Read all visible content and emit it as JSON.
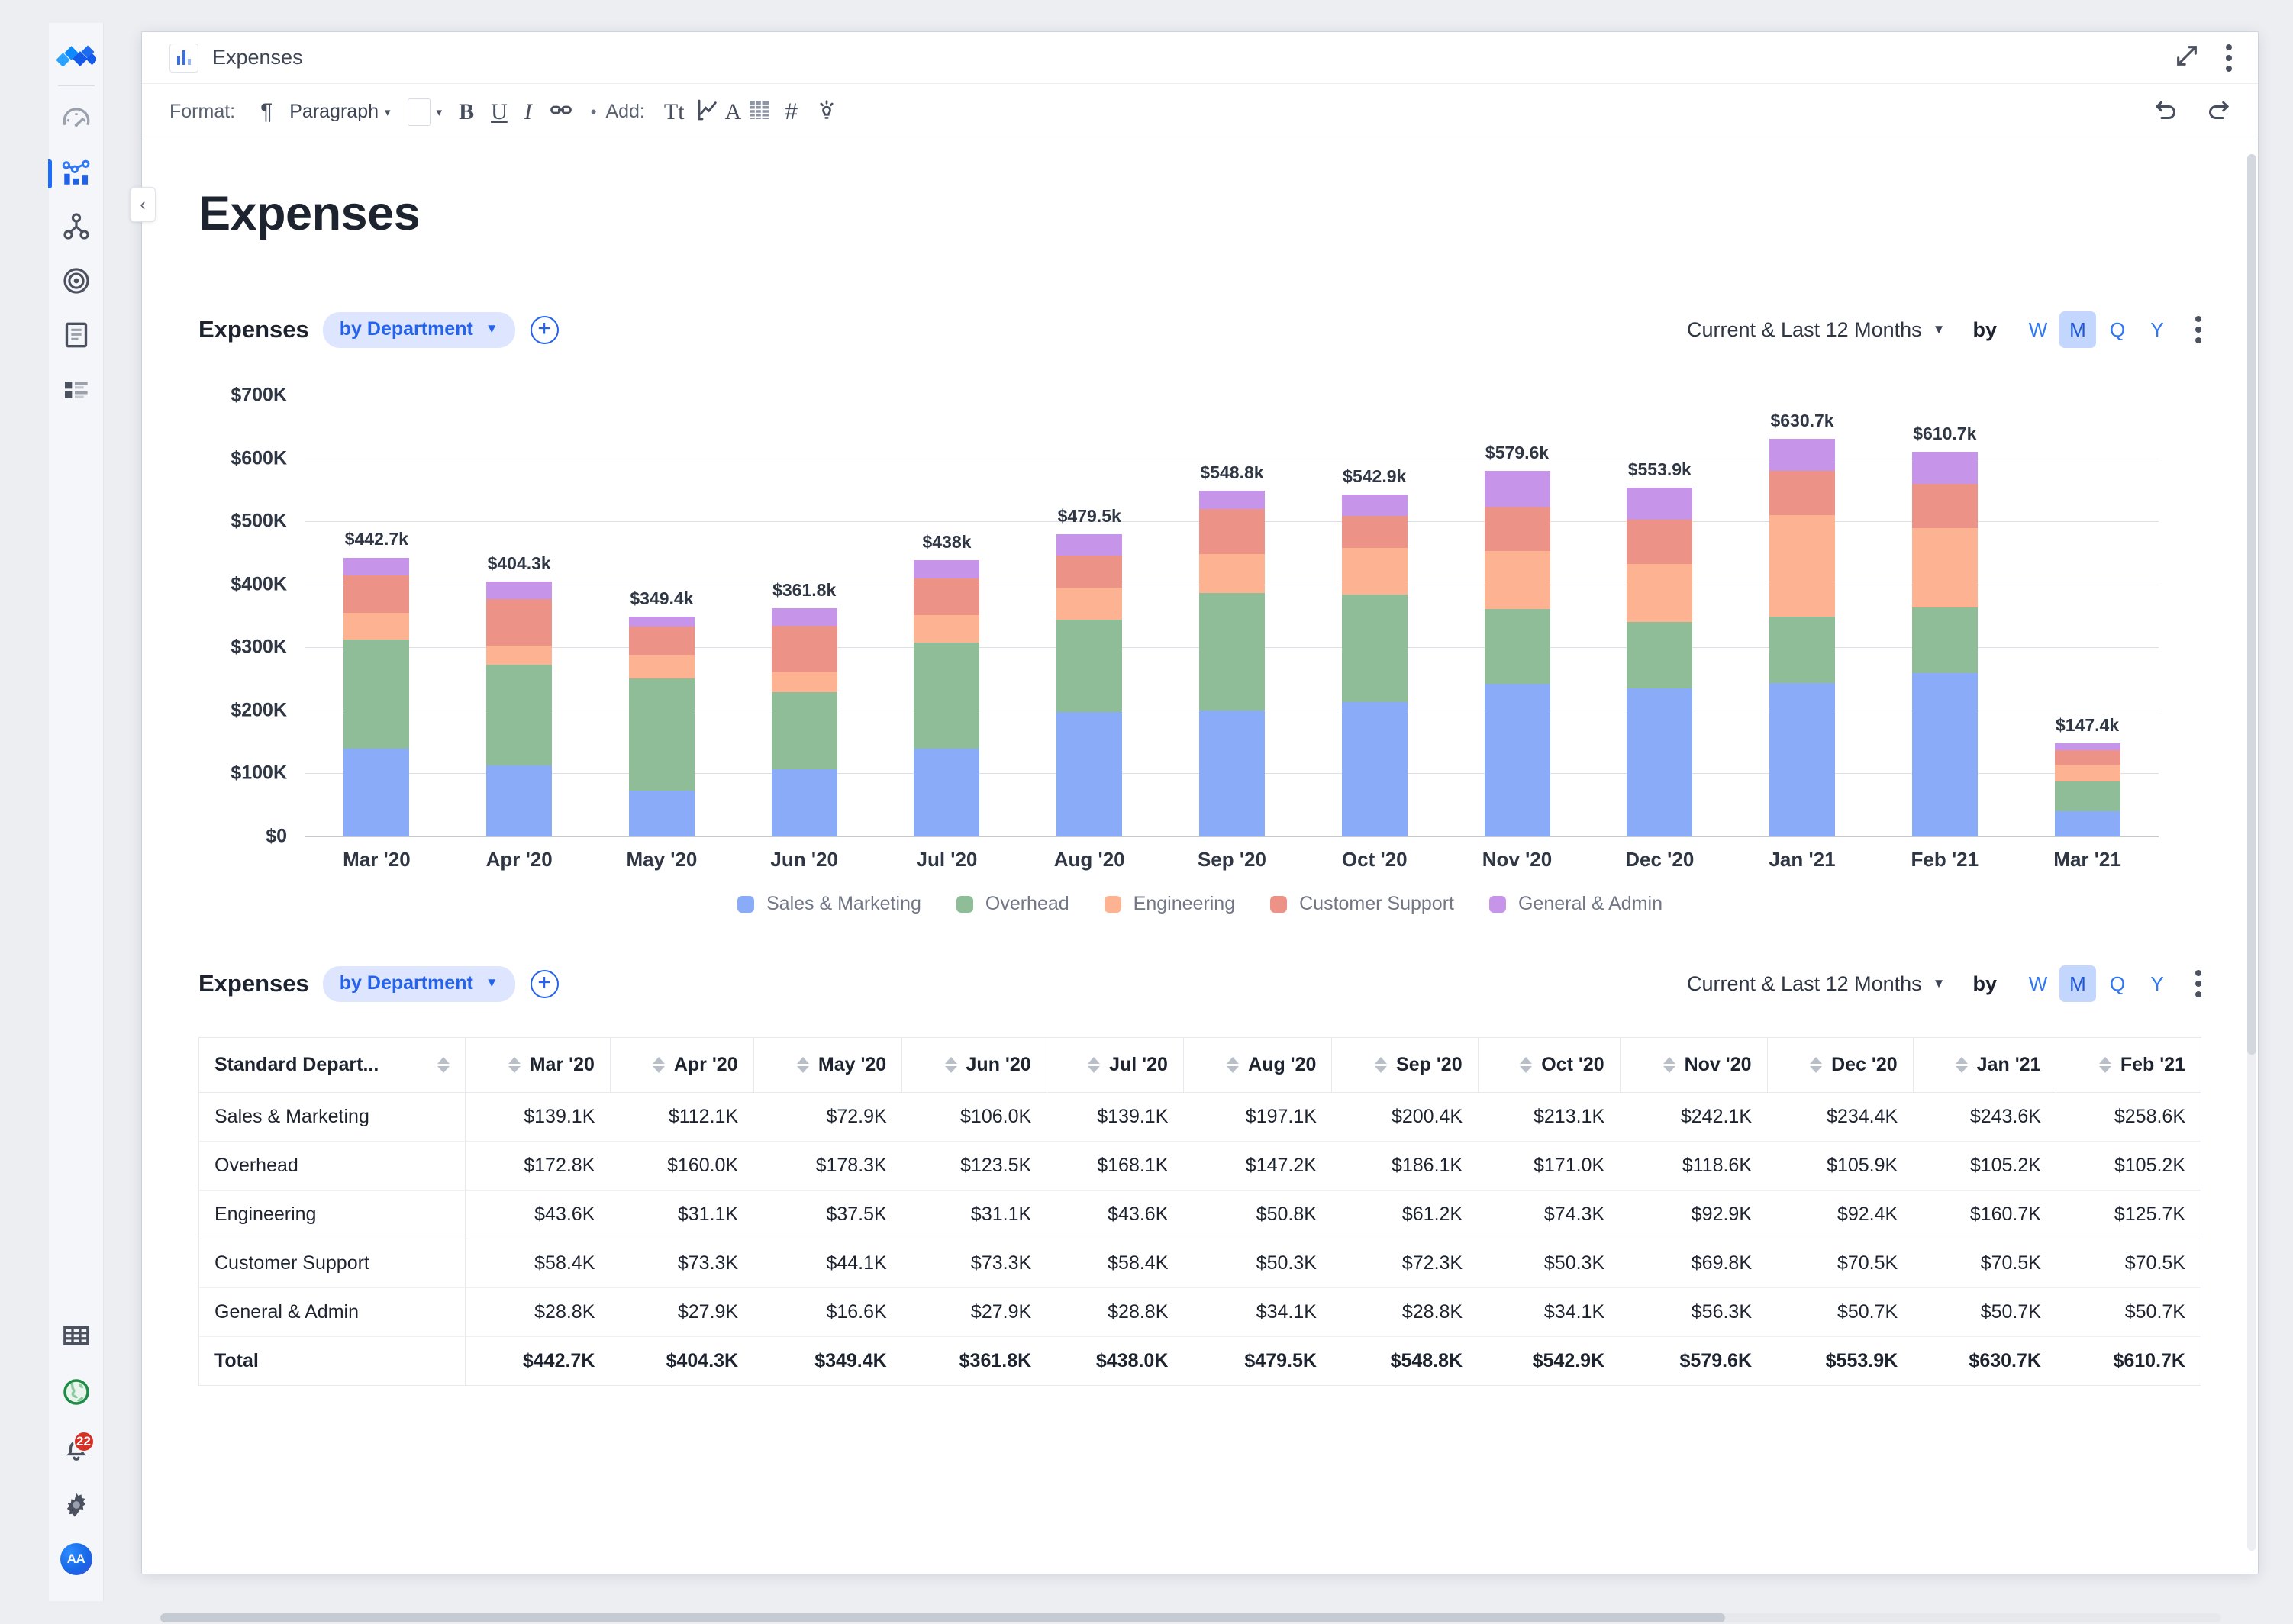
{
  "app": {
    "logo_icon": "diamond-cluster-logo",
    "rail_items": [
      {
        "icon": "gauge-icon",
        "name": "dashboard"
      },
      {
        "icon": "chart-network-icon",
        "name": "metrics",
        "active": true
      },
      {
        "icon": "share-nodes-icon",
        "name": "relationships"
      },
      {
        "icon": "target-icon",
        "name": "goals"
      },
      {
        "icon": "document-icon",
        "name": "documents"
      },
      {
        "icon": "list-detail-icon",
        "name": "reports"
      }
    ],
    "rail_bottom": [
      {
        "icon": "table-grid-icon",
        "name": "data-tables"
      },
      {
        "icon": "globe-icon",
        "name": "explore"
      },
      {
        "icon": "bell-icon",
        "name": "notifications",
        "badge": "22"
      },
      {
        "icon": "gear-icon",
        "name": "settings"
      },
      {
        "icon": "avatar",
        "name": "user-avatar",
        "initials": "AA"
      }
    ]
  },
  "window": {
    "doc_icon": "bar-chart-doc-icon",
    "title": "Expenses",
    "expand_icon": "expand-arrow-icon",
    "menu_icon": "kebab-menu-icon"
  },
  "toolbar": {
    "format_label": "Format:",
    "paragraph_icon": "pilcrow-icon",
    "paragraph_label": "Paragraph",
    "color_swatch": "#ffffff",
    "bold_label": "B",
    "underline_label": "U",
    "italic_label": "I",
    "link_icon": "link-icon",
    "separator": "•",
    "add_label": "Add:",
    "text_icon": "Tt",
    "chart_icon": "line-chart-icon",
    "text_a_icon": "A",
    "table_icon": "table-icon",
    "hash_icon": "#",
    "insight_icon": "lightbulb-icon",
    "undo_icon": "undo-icon",
    "redo_icon": "redo-icon"
  },
  "collapse_handle_icon": "chevron-left-icon",
  "page": {
    "title": "Expenses"
  },
  "chart_block": {
    "title": "Expenses",
    "group_pill": "by Department",
    "pill_caret": "▼",
    "add_icon": "plus-circle-icon",
    "range": "Current & Last 12 Months",
    "range_caret": "▼",
    "by_label": "by",
    "granularity": [
      "W",
      "M",
      "Q",
      "Y"
    ],
    "granularity_selected": "M",
    "menu_icon": "kebab-menu-icon"
  },
  "table_block": {
    "title": "Expenses",
    "group_pill": "by Department",
    "pill_caret": "▼",
    "add_icon": "plus-circle-icon",
    "range": "Current & Last 12 Months",
    "range_caret": "▼",
    "by_label": "by",
    "granularity": [
      "W",
      "M",
      "Q",
      "Y"
    ],
    "granularity_selected": "M",
    "menu_icon": "kebab-menu-icon"
  },
  "chart_data": {
    "type": "bar",
    "stacked": true,
    "title": "Expenses",
    "xlabel": "",
    "ylabel": "",
    "ylim": [
      0,
      700000
    ],
    "ytick_labels": [
      "$0",
      "$100K",
      "$200K",
      "$300K",
      "$400K",
      "$500K",
      "$600K",
      "$700K"
    ],
    "ytick_values": [
      0,
      100000,
      200000,
      300000,
      400000,
      500000,
      600000,
      700000
    ],
    "grid": true,
    "legend_position": "bottom",
    "categories": [
      "Mar '20",
      "Apr '20",
      "May '20",
      "Jun '20",
      "Jul '20",
      "Aug '20",
      "Sep '20",
      "Oct '20",
      "Nov '20",
      "Dec '20",
      "Jan '21",
      "Feb '21",
      "Mar '21"
    ],
    "series": [
      {
        "name": "Sales & Marketing",
        "color": "#8aabf7",
        "values": [
          139100,
          112100,
          72900,
          106000,
          139100,
          197100,
          200400,
          213100,
          242100,
          234400,
          243600,
          258600,
          39900
        ]
      },
      {
        "name": "Overhead",
        "color": "#8ebd97",
        "values": [
          172800,
          160000,
          178300,
          123500,
          168100,
          147200,
          186100,
          171000,
          118600,
          105900,
          105200,
          105200,
          47900
        ]
      },
      {
        "name": "Engineering",
        "color": "#fdb391",
        "values": [
          43600,
          31100,
          37500,
          31100,
          43600,
          50800,
          61200,
          74300,
          92900,
          92400,
          160700,
          125700,
          26300
        ]
      },
      {
        "name": "Customer Support",
        "color": "#ec9287",
        "values": [
          58400,
          73300,
          44100,
          73300,
          58400,
          50300,
          72300,
          50300,
          69800,
          70500,
          70500,
          70500,
          23100
        ]
      },
      {
        "name": "General & Admin",
        "color": "#c694e8",
        "values": [
          28800,
          27900,
          16600,
          27900,
          28800,
          34100,
          28800,
          34100,
          56300,
          50700,
          50700,
          50700,
          10200
        ]
      }
    ],
    "totals": [
      442700,
      404300,
      349400,
      361800,
      438000,
      479500,
      548800,
      542900,
      579600,
      553900,
      630700,
      610700,
      147400
    ],
    "total_labels": [
      "$442.7k",
      "$404.3k",
      "$349.4k",
      "$361.8k",
      "$438k",
      "$479.5k",
      "$548.8k",
      "$542.9k",
      "$579.6k",
      "$553.9k",
      "$630.7k",
      "$610.7k",
      "$147.4k"
    ]
  },
  "table_data": {
    "type": "table",
    "columns": [
      "Standard Depart...",
      "Mar '20",
      "Apr '20",
      "May '20",
      "Jun '20",
      "Jul '20",
      "Aug '20",
      "Sep '20",
      "Oct '20",
      "Nov '20",
      "Dec '20",
      "Jan '21",
      "Feb '21"
    ],
    "rows": [
      {
        "label": "Sales & Marketing",
        "values": [
          "$139.1K",
          "$112.1K",
          "$72.9K",
          "$106.0K",
          "$139.1K",
          "$197.1K",
          "$200.4K",
          "$213.1K",
          "$242.1K",
          "$234.4K",
          "$243.6K",
          "$258.6K"
        ]
      },
      {
        "label": "Overhead",
        "values": [
          "$172.8K",
          "$160.0K",
          "$178.3K",
          "$123.5K",
          "$168.1K",
          "$147.2K",
          "$186.1K",
          "$171.0K",
          "$118.6K",
          "$105.9K",
          "$105.2K",
          "$105.2K"
        ]
      },
      {
        "label": "Engineering",
        "values": [
          "$43.6K",
          "$31.1K",
          "$37.5K",
          "$31.1K",
          "$43.6K",
          "$50.8K",
          "$61.2K",
          "$74.3K",
          "$92.9K",
          "$92.4K",
          "$160.7K",
          "$125.7K"
        ]
      },
      {
        "label": "Customer Support",
        "values": [
          "$58.4K",
          "$73.3K",
          "$44.1K",
          "$73.3K",
          "$58.4K",
          "$50.3K",
          "$72.3K",
          "$50.3K",
          "$69.8K",
          "$70.5K",
          "$70.5K",
          "$70.5K"
        ]
      },
      {
        "label": "General & Admin",
        "values": [
          "$28.8K",
          "$27.9K",
          "$16.6K",
          "$27.9K",
          "$28.8K",
          "$34.1K",
          "$28.8K",
          "$34.1K",
          "$56.3K",
          "$50.7K",
          "$50.7K",
          "$50.7K"
        ]
      },
      {
        "label": "Total",
        "values": [
          "$442.7K",
          "$404.3K",
          "$349.4K",
          "$361.8K",
          "$438.0K",
          "$479.5K",
          "$548.8K",
          "$542.9K",
          "$579.6K",
          "$553.9K",
          "$630.7K",
          "$610.7K"
        ]
      }
    ]
  },
  "colors": {
    "accent": "#2563eb",
    "badge": "#d93025",
    "sales_marketing": "#8aabf7",
    "overhead": "#8ebd97",
    "engineering": "#fdb391",
    "customer_support": "#ec9287",
    "general_admin": "#c694e8"
  }
}
